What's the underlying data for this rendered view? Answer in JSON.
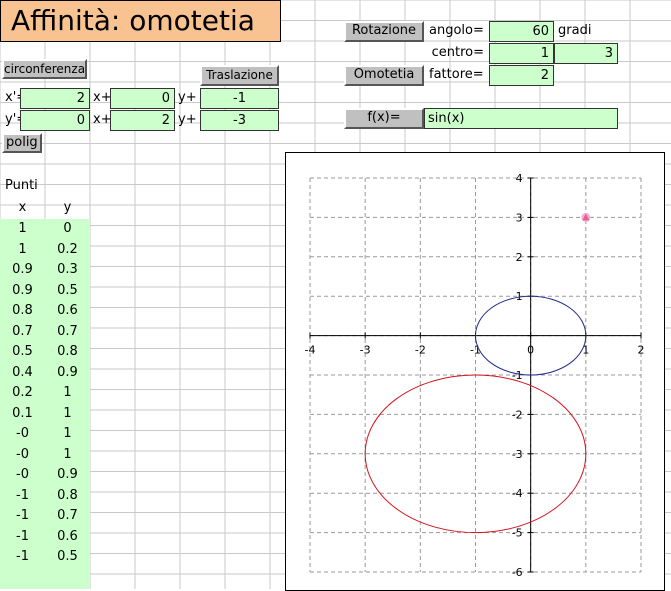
{
  "title": "Affinità: omotetia",
  "buttons": {
    "circonferenza": "circonferenza",
    "traslazione": "Traslazione",
    "polig": "polig",
    "rotazione": "Rotazione",
    "omotetia": "Omotetia",
    "fx": "f(x)="
  },
  "translation_rows": [
    {
      "label": "x'=",
      "v1": "2",
      "op1": "x+",
      "v2": "0",
      "op2": "y+",
      "v3": "-1"
    },
    {
      "label": "y'=",
      "v1": "0",
      "op1": "x+",
      "v2": "2",
      "op2": "y+",
      "v3": "-3"
    }
  ],
  "rotation": {
    "angolo_label": "angolo=",
    "angolo_value": "60",
    "angolo_unit": "gradi",
    "centro_label": "centro=",
    "centro_x": "1",
    "centro_y": "3",
    "fattore_label": "fattore=",
    "fattore_value": "2"
  },
  "function": {
    "expr": "sin(x)"
  },
  "points": {
    "header": "Punti",
    "col_x": "x",
    "col_y": "y",
    "rows": [
      [
        "1",
        "0"
      ],
      [
        "1",
        "0.2"
      ],
      [
        "0.9",
        "0.3"
      ],
      [
        "0.9",
        "0.5"
      ],
      [
        "0.8",
        "0.6"
      ],
      [
        "0.7",
        "0.7"
      ],
      [
        "0.5",
        "0.8"
      ],
      [
        "0.4",
        "0.9"
      ],
      [
        "0.2",
        "1"
      ],
      [
        "0.1",
        "1"
      ],
      [
        "-0",
        "1"
      ],
      [
        "-0",
        "1"
      ],
      [
        "-0",
        "0.9"
      ],
      [
        "-1",
        "0.8"
      ],
      [
        "-1",
        "0.7"
      ],
      [
        "-1",
        "0.6"
      ],
      [
        "-1",
        "0.5"
      ]
    ]
  },
  "colors": {
    "circle": "#1f2a8a",
    "ellipse": "#d0141e",
    "marker": "#e060a0"
  },
  "chart_data": {
    "type": "scatter",
    "xlim": [
      -4,
      2
    ],
    "ylim": [
      -6,
      4
    ],
    "x_ticks": [
      "-4",
      "-3",
      "-2",
      "-1",
      "0",
      "1",
      "2"
    ],
    "y_ticks": [
      "4",
      "3",
      "2",
      "1",
      "0",
      "-1",
      "-2",
      "-3",
      "-4",
      "-5",
      "-6"
    ],
    "grid": true,
    "series": [
      {
        "shape": "circle",
        "center": [
          0,
          0
        ],
        "rx": 1,
        "ry": 1
      },
      {
        "shape": "ellipse",
        "center": [
          -1,
          -3
        ],
        "rx": 2,
        "ry": 2
      }
    ],
    "marker": {
      "x": 1,
      "y": 3
    }
  }
}
